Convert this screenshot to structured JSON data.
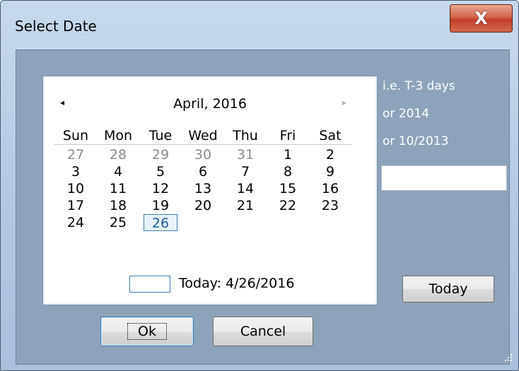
{
  "window": {
    "title": "Select Date",
    "close_glyph": "X"
  },
  "calendar": {
    "month_label": "April, 2016",
    "prev_icon": "◂",
    "next_icon": "▸",
    "weekdays": [
      "Sun",
      "Mon",
      "Tue",
      "Wed",
      "Thu",
      "Fri",
      "Sat"
    ],
    "weeks": [
      [
        "27",
        "28",
        "29",
        "30",
        "31",
        "1",
        "2"
      ],
      [
        "3",
        "4",
        "5",
        "6",
        "7",
        "8",
        "9"
      ],
      [
        "10",
        "11",
        "12",
        "13",
        "14",
        "15",
        "16"
      ],
      [
        "17",
        "18",
        "19",
        "20",
        "21",
        "22",
        "23"
      ],
      [
        "24",
        "25",
        "26",
        "",
        "",
        "",
        ""
      ]
    ],
    "selected_day": "26",
    "today_label": "Today: 4/26/2016"
  },
  "hints": [
    "i.e. T-3 days",
    "or 2014",
    "or 10/2013"
  ],
  "date_input": {
    "value": ""
  },
  "buttons": {
    "today": "Today",
    "ok": "Ok",
    "cancel": "Cancel"
  },
  "colors": {
    "client_bg": "#8ea3b9",
    "close_red": "#c1412a",
    "selection_blue": "#3c7fb1"
  }
}
